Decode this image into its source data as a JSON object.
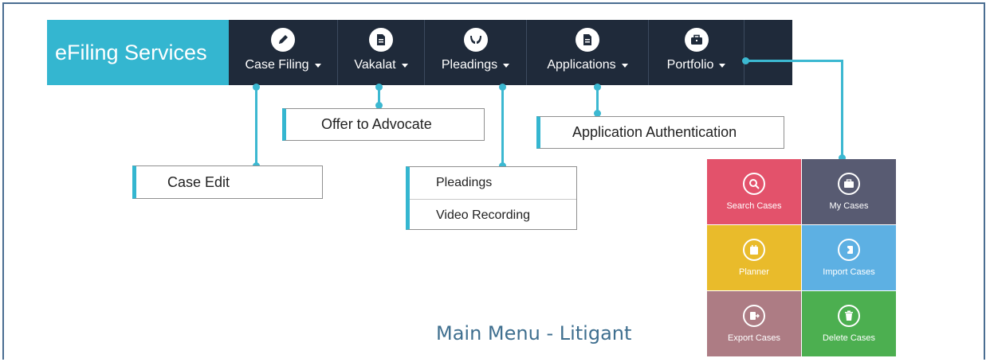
{
  "header": {
    "brand": "eFiling Services",
    "nav": [
      {
        "label": "Case Filing",
        "icon": "pencil-icon"
      },
      {
        "label": "Vakalat",
        "icon": "document-icon"
      },
      {
        "label": "Pleadings",
        "icon": "hands-icon"
      },
      {
        "label": "Applications",
        "icon": "file-icon"
      },
      {
        "label": "Portfolio",
        "icon": "briefcase-icon"
      }
    ]
  },
  "dropdowns": {
    "case_filing": [
      "Case Edit"
    ],
    "vakalat": [
      "Offer to Advocate"
    ],
    "pleadings": [
      "Pleadings",
      "Video Recording"
    ],
    "applications": [
      "Application Authentication"
    ]
  },
  "portfolio_tiles": [
    {
      "label": "Search Cases",
      "icon": "search-icon",
      "color": "#e3526b"
    },
    {
      "label": "My Cases",
      "icon": "briefcase-icon",
      "color": "#585b72"
    },
    {
      "label": "Planner",
      "icon": "calendar-icon",
      "color": "#e9bb2b"
    },
    {
      "label": "Import Cases",
      "icon": "import-icon",
      "color": "#5db0e3"
    },
    {
      "label": "Export Cases",
      "icon": "export-icon",
      "color": "#ad7c84"
    },
    {
      "label": "Delete Cases",
      "icon": "trash-icon",
      "color": "#4caf50"
    }
  ],
  "caption": "Main Menu - Litigant",
  "colors": {
    "accent": "#34b6d0",
    "navbar": "#1f2a3a",
    "caption": "#3f6f8f"
  }
}
